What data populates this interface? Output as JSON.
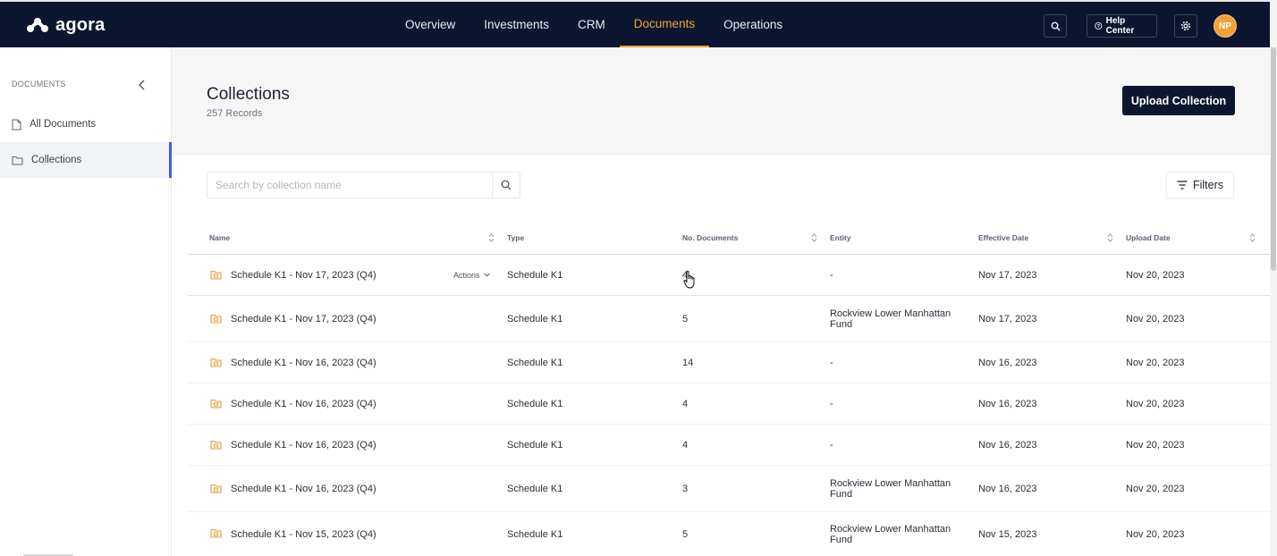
{
  "app": {
    "logo_text": "agora"
  },
  "nav": {
    "items": [
      {
        "label": "Overview"
      },
      {
        "label": "Investments"
      },
      {
        "label": "CRM"
      },
      {
        "label": "Documents",
        "active": true
      },
      {
        "label": "Operations"
      }
    ],
    "help_label": "Help Center",
    "avatar_initials": "NP",
    "accent_color": "#f0a23a",
    "bg_color": "#0c1630"
  },
  "sidebar": {
    "header": "DOCUMENTS",
    "items": [
      {
        "label": "All Documents",
        "icon": "document-icon"
      },
      {
        "label": "Collections",
        "icon": "folder-icon",
        "active": true
      }
    ]
  },
  "page": {
    "title": "Collections",
    "records": "257 Records",
    "upload_label": "Upload Collection",
    "search_placeholder": "Search by collection name",
    "filters_label": "Filters"
  },
  "table": {
    "columns": [
      "Name",
      "Type",
      "No. Documents",
      "Entity",
      "Effective Date",
      "Upload Date"
    ],
    "actions_label": "Actions",
    "rows": [
      {
        "name": "Schedule K1 - Nov 17, 2023 (Q4)",
        "type": "Schedule K1",
        "docs": "4",
        "entity": "-",
        "effective": "Nov 17, 2023",
        "upload": "Nov 20, 2023"
      },
      {
        "name": "Schedule K1 - Nov 17, 2023 (Q4)",
        "type": "Schedule K1",
        "docs": "5",
        "entity": "Rockview Lower Manhattan Fund",
        "effective": "Nov 17, 2023",
        "upload": "Nov 20, 2023"
      },
      {
        "name": "Schedule K1 - Nov 16, 2023 (Q4)",
        "type": "Schedule K1",
        "docs": "14",
        "entity": "-",
        "effective": "Nov 16, 2023",
        "upload": "Nov 20, 2023"
      },
      {
        "name": "Schedule K1 - Nov 16, 2023 (Q4)",
        "type": "Schedule K1",
        "docs": "4",
        "entity": "-",
        "effective": "Nov 16, 2023",
        "upload": "Nov 20, 2023"
      },
      {
        "name": "Schedule K1 - Nov 16, 2023 (Q4)",
        "type": "Schedule K1",
        "docs": "4",
        "entity": "-",
        "effective": "Nov 16, 2023",
        "upload": "Nov 20, 2023"
      },
      {
        "name": "Schedule K1 - Nov 16, 2023 (Q4)",
        "type": "Schedule K1",
        "docs": "3",
        "entity": "Rockview Lower Manhattan Fund",
        "effective": "Nov 16, 2023",
        "upload": "Nov 20, 2023"
      },
      {
        "name": "Schedule K1 - Nov 15, 2023 (Q4)",
        "type": "Schedule K1",
        "docs": "5",
        "entity": "Rockview Lower Manhattan Fund",
        "effective": "Nov 15, 2023",
        "upload": "Nov 20, 2023"
      }
    ]
  }
}
